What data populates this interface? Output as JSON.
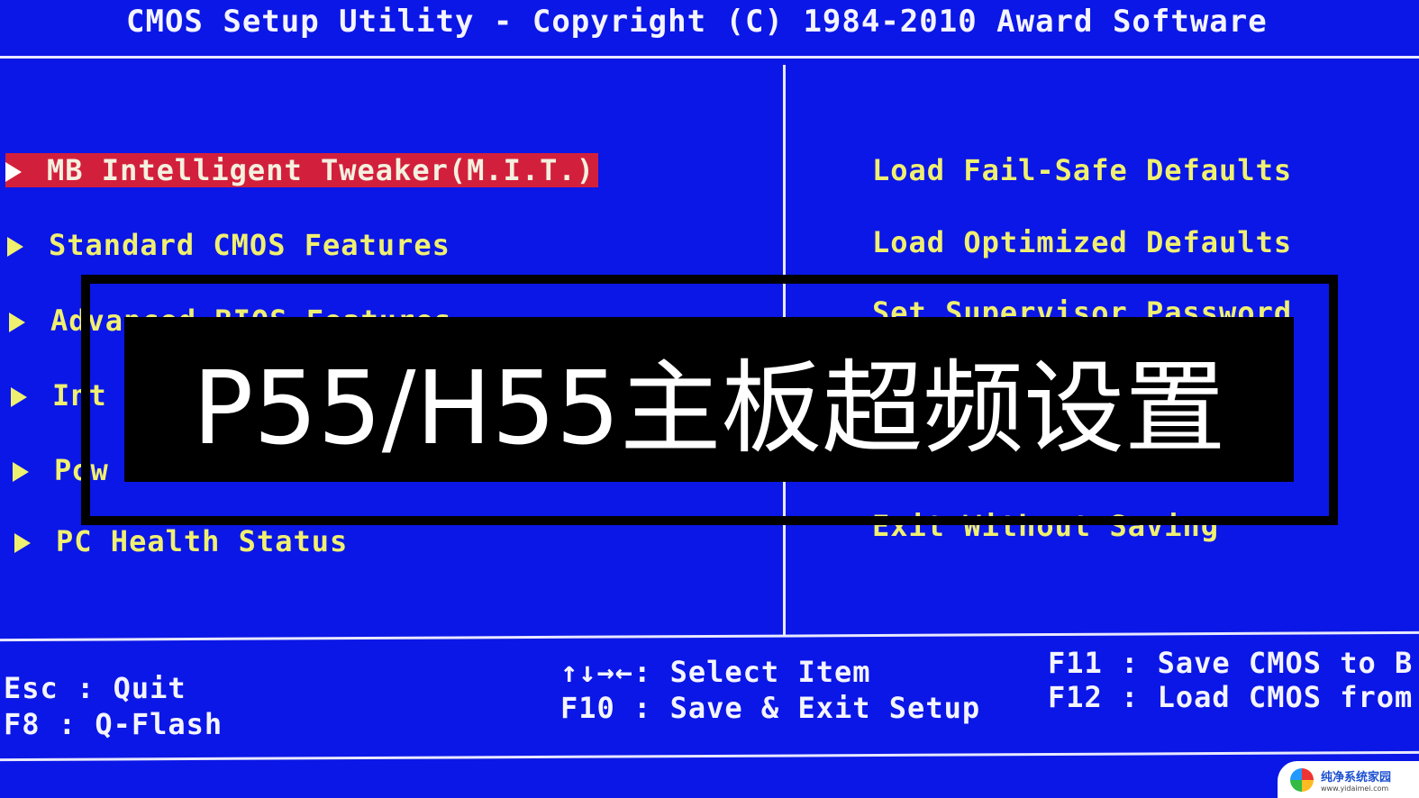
{
  "header": {
    "title": "CMOS Setup Utility - Copyright (C) 1984-2010 Award Software"
  },
  "left_menu": [
    {
      "label": "MB Intelligent Tweaker(M.I.T.)",
      "selected": true
    },
    {
      "label": "Standard CMOS Features"
    },
    {
      "label": "Advanced BIOS Features"
    },
    {
      "label": "Int"
    },
    {
      "label": "Pow"
    },
    {
      "label": "PC Health Status"
    }
  ],
  "right_menu": [
    {
      "label": "Load Fail-Safe Defaults"
    },
    {
      "label": "Load Optimized Defaults"
    },
    {
      "label": "Set Supervisor Password"
    },
    {
      "label": "Exit Without Saving"
    }
  ],
  "footer": {
    "esc": "Esc  : Quit",
    "f8": "F8   : Q-Flash",
    "arrows": "↑↓→←: Select Item",
    "f10": "F10  : Save & Exit Setup",
    "f11": "F11  : Save CMOS to B",
    "f12": "F12  : Load CMOS from"
  },
  "overlay": {
    "title": "P55/H55主板超频设置"
  },
  "watermark": {
    "name": "纯净系统家园",
    "url": "www.yidaimei.com"
  },
  "colors": {
    "background": "#0b17e6",
    "menu_text": "#f0f070",
    "selected": "#d2203c"
  }
}
